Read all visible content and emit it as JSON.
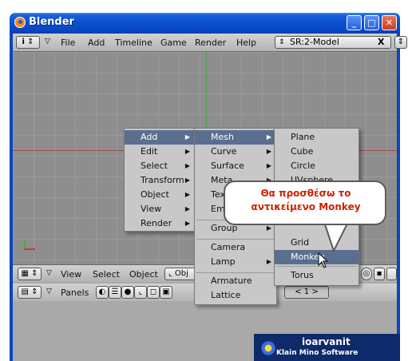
{
  "window": {
    "title": "Blender"
  },
  "top_header": {
    "menus": [
      "File",
      "Add",
      "Timeline",
      "Game",
      "Render",
      "Help"
    ],
    "scene_field": "SR:2-Model",
    "scene_close": "X"
  },
  "view_header": {
    "menus": [
      "View",
      "Select",
      "Object"
    ],
    "mode_label": "Obj"
  },
  "buttons_header": {
    "panels_label": "Panels",
    "pager": "<   1   >"
  },
  "add_menu": {
    "items": [
      "Add",
      "Edit",
      "Select",
      "Transform",
      "Object",
      "View",
      "Render"
    ]
  },
  "category_menu": {
    "items": [
      "Mesh",
      "Curve",
      "Surface",
      "Meta",
      "Text",
      "Empty",
      "Group",
      "Camera",
      "Lamp",
      "Armature",
      "Lattice"
    ]
  },
  "mesh_menu": {
    "items": [
      "Plane",
      "Cube",
      "Circle",
      "UVsphere",
      "Grid",
      "Monkey",
      "Torus"
    ]
  },
  "callout": {
    "line1": "Θα προσθέσω το",
    "line2": "αντικείμενο Monkey"
  },
  "watermark": {
    "name": "ioarvanit",
    "subtitle": "Klain Mino Software"
  },
  "colors": {
    "highlight": "#5a6f8f",
    "callout_text": "#cc2200"
  }
}
